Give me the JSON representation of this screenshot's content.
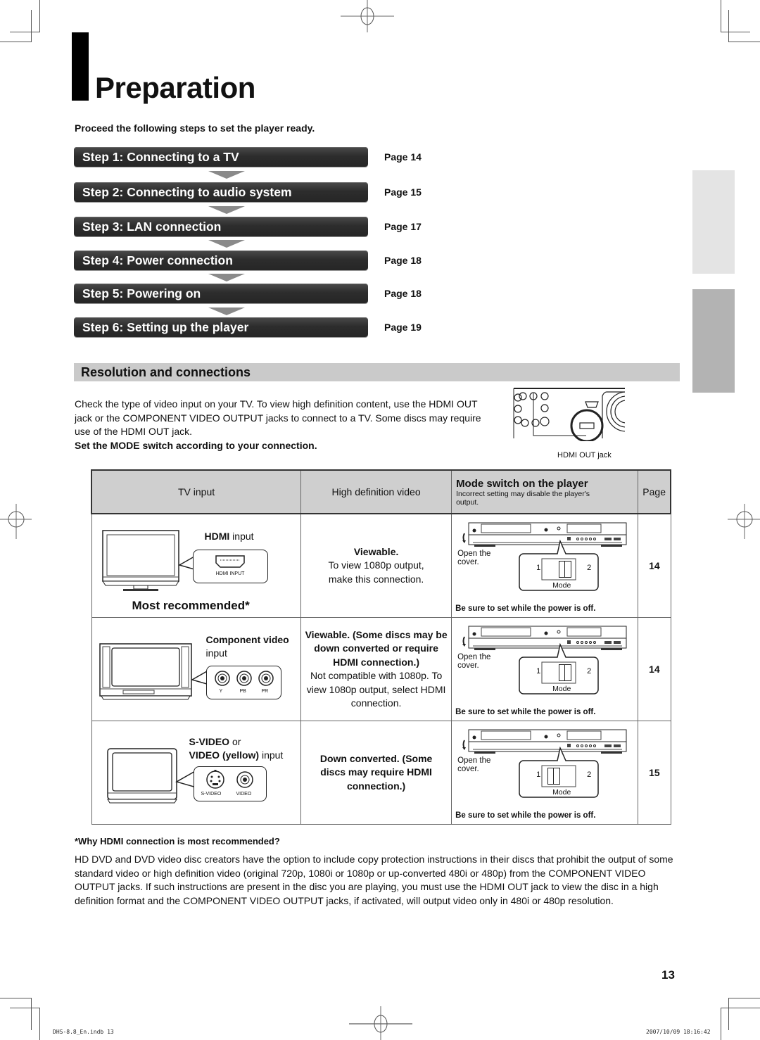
{
  "title": "Preparation",
  "intro": "Proceed the following steps to set the player ready.",
  "steps": [
    {
      "label": "Step 1: Connecting to a TV",
      "page": "Page 14"
    },
    {
      "label": "Step 2: Connecting to audio system",
      "page": "Page 15"
    },
    {
      "label": "Step 3: LAN connection",
      "page": "Page 17"
    },
    {
      "label": "Step 4: Power connection",
      "page": "Page 18"
    },
    {
      "label": "Step 5: Powering on",
      "page": "Page 18"
    },
    {
      "label": "Step 6: Setting up the player",
      "page": "Page 19"
    }
  ],
  "section": {
    "title": "Resolution and connections",
    "paragraph": "Check the type of video input on your TV. To view high definition content, use the HDMI OUT jack or the COMPONENT VIDEO OUTPUT jacks to connect to a TV. Some discs may require use of the HDMI OUT jack.",
    "instruction": "Set the MODE switch  according to your connection.",
    "figure_caption": "HDMI OUT jack"
  },
  "table": {
    "headers": {
      "tv_input": "TV input",
      "hd_video": "High definition video",
      "mode_title": "Mode switch on the player",
      "mode_note": "Incorrect setting may disable the player's output.",
      "page": "Page"
    },
    "rows": [
      {
        "input_bold": "HDMI",
        "input_rest": " input",
        "jack_labels": [
          "HDMI INPUT"
        ],
        "recommendation": "Most recommended*",
        "hd_bold": "Viewable.",
        "hd_text": "To view 1080p output, make this connection.",
        "mode_position": "2",
        "page": "14"
      },
      {
        "input_bold": "Component video",
        "input_rest": "input",
        "jack_labels": [
          "Y",
          "PB",
          "PR"
        ],
        "hd_bold": "Viewable. (Some discs may be down converted or require HDMI connection.)",
        "hd_text": "Not compatible with 1080p. To view 1080p output, select HDMI connection.",
        "mode_position": "2",
        "page": "14"
      },
      {
        "input_bold": "S-VIDEO",
        "input_rest": " or",
        "input_bold2": "VIDEO (yellow)",
        "input_rest2": " input",
        "jack_labels": [
          "S-VIDEO",
          "VIDEO"
        ],
        "hd_bold": "Down converted. (Some discs may require HDMI connection.)",
        "hd_text": "",
        "mode_position": "1",
        "page": "15"
      }
    ],
    "mode_common": {
      "open_cover": "Open the cover.",
      "pos1": "1",
      "pos2": "2",
      "mode_label": "Mode",
      "warning": "Be sure to set while the power is off."
    }
  },
  "footnote": {
    "heading": "*Why HDMI connection is most recommended?",
    "text": "HD DVD and DVD video disc creators have the option to include copy protection instructions in their discs that prohibit the output of some standard video or high definition video (original 720p, 1080i or 1080p or up-converted 480i or 480p) from the COMPONENT VIDEO OUTPUT jacks. If such instructions are present in the disc you are playing, you must use the HDMI OUT jack to view the disc in a high definition format and the COMPONENT VIDEO OUTPUT jacks, if activated, will output video only in 480i or 480p resolution."
  },
  "page_number": "13",
  "slug": {
    "file": "DHS-8.8_En.indb   13",
    "timestamp": "2007/10/09   18:16:42"
  }
}
